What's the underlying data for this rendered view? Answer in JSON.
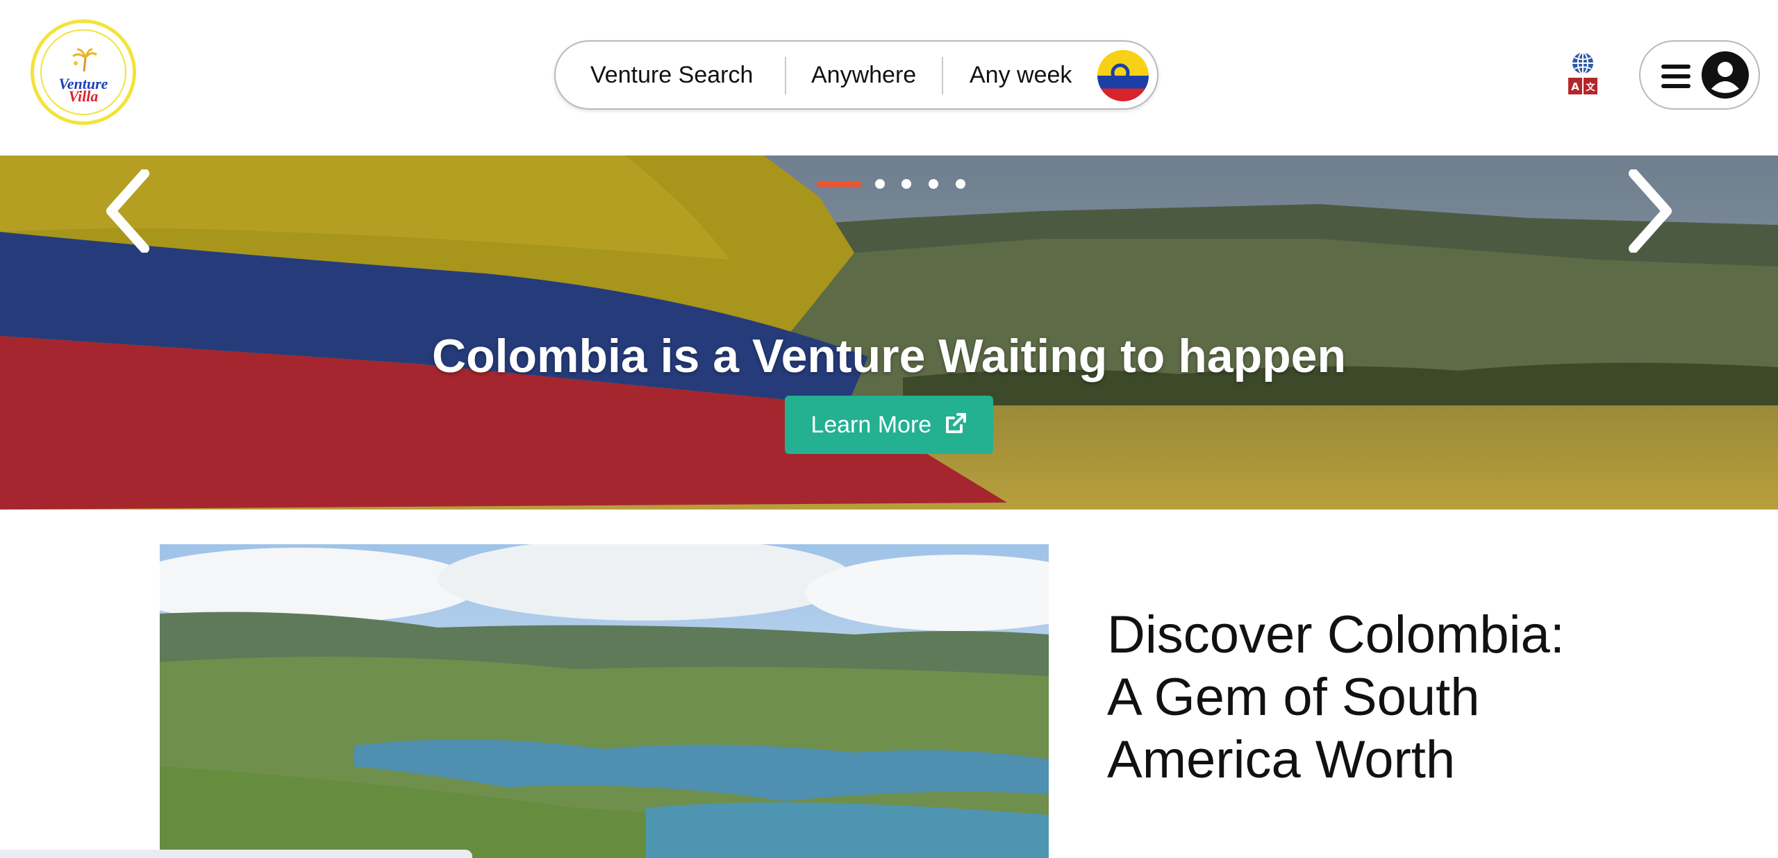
{
  "header": {
    "logo": {
      "line1": "Venture",
      "line2": "Villa",
      "icon": "palm-tree-icon"
    },
    "search": {
      "venture_label": "Venture Search",
      "where_label": "Anywhere",
      "when_label": "Any week",
      "button_icon": "search-icon"
    },
    "language_icon": "translate-globe-icon",
    "menu_icon": "hamburger-icon",
    "avatar_icon": "user-avatar-icon"
  },
  "hero": {
    "title": "Colombia is a Venture Waiting to happen",
    "cta_label": "Learn More",
    "cta_icon": "external-link-icon",
    "slide_count": 5,
    "active_slide": 1,
    "prev_icon": "chevron-left-icon",
    "next_icon": "chevron-right-icon"
  },
  "feature": {
    "heading": "Discover Colombia: A Gem of South America Worth"
  },
  "colors": {
    "accent": "#23b192",
    "indicator_active": "#f0522c",
    "flag_yellow": "#f7d117",
    "flag_blue": "#1b3fa6",
    "flag_red": "#d8232a"
  }
}
